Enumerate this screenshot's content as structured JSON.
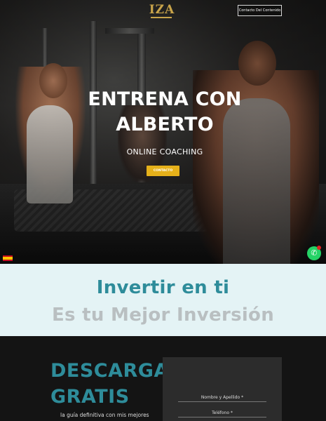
{
  "header": {
    "logo_text": "IZA",
    "contact_button": "Contacto Del Contenido"
  },
  "hero": {
    "title": "ENTRENA CON ALBERTO",
    "subtitle": "ONLINE COACHING",
    "cta_label": "CONTACTO"
  },
  "widgets": {
    "language_flag": "es-flag-icon",
    "whatsapp_icon": "whatsapp-icon"
  },
  "invest": {
    "line1": "Invertir en ti",
    "line2": "Es tu Mejor Inversión"
  },
  "download": {
    "title": "DESCARGA GRATIS",
    "description": "la guía definitiva con mis mejores",
    "fields": [
      "Nombre y Apellido *",
      "Teléfono *"
    ]
  },
  "colors": {
    "accent_teal": "#2e8c9a",
    "cta_yellow": "#e6b11a",
    "logo_gold": "#c9a44a",
    "invest_bg": "#e4f3f5",
    "whatsapp_green": "#25d366"
  }
}
